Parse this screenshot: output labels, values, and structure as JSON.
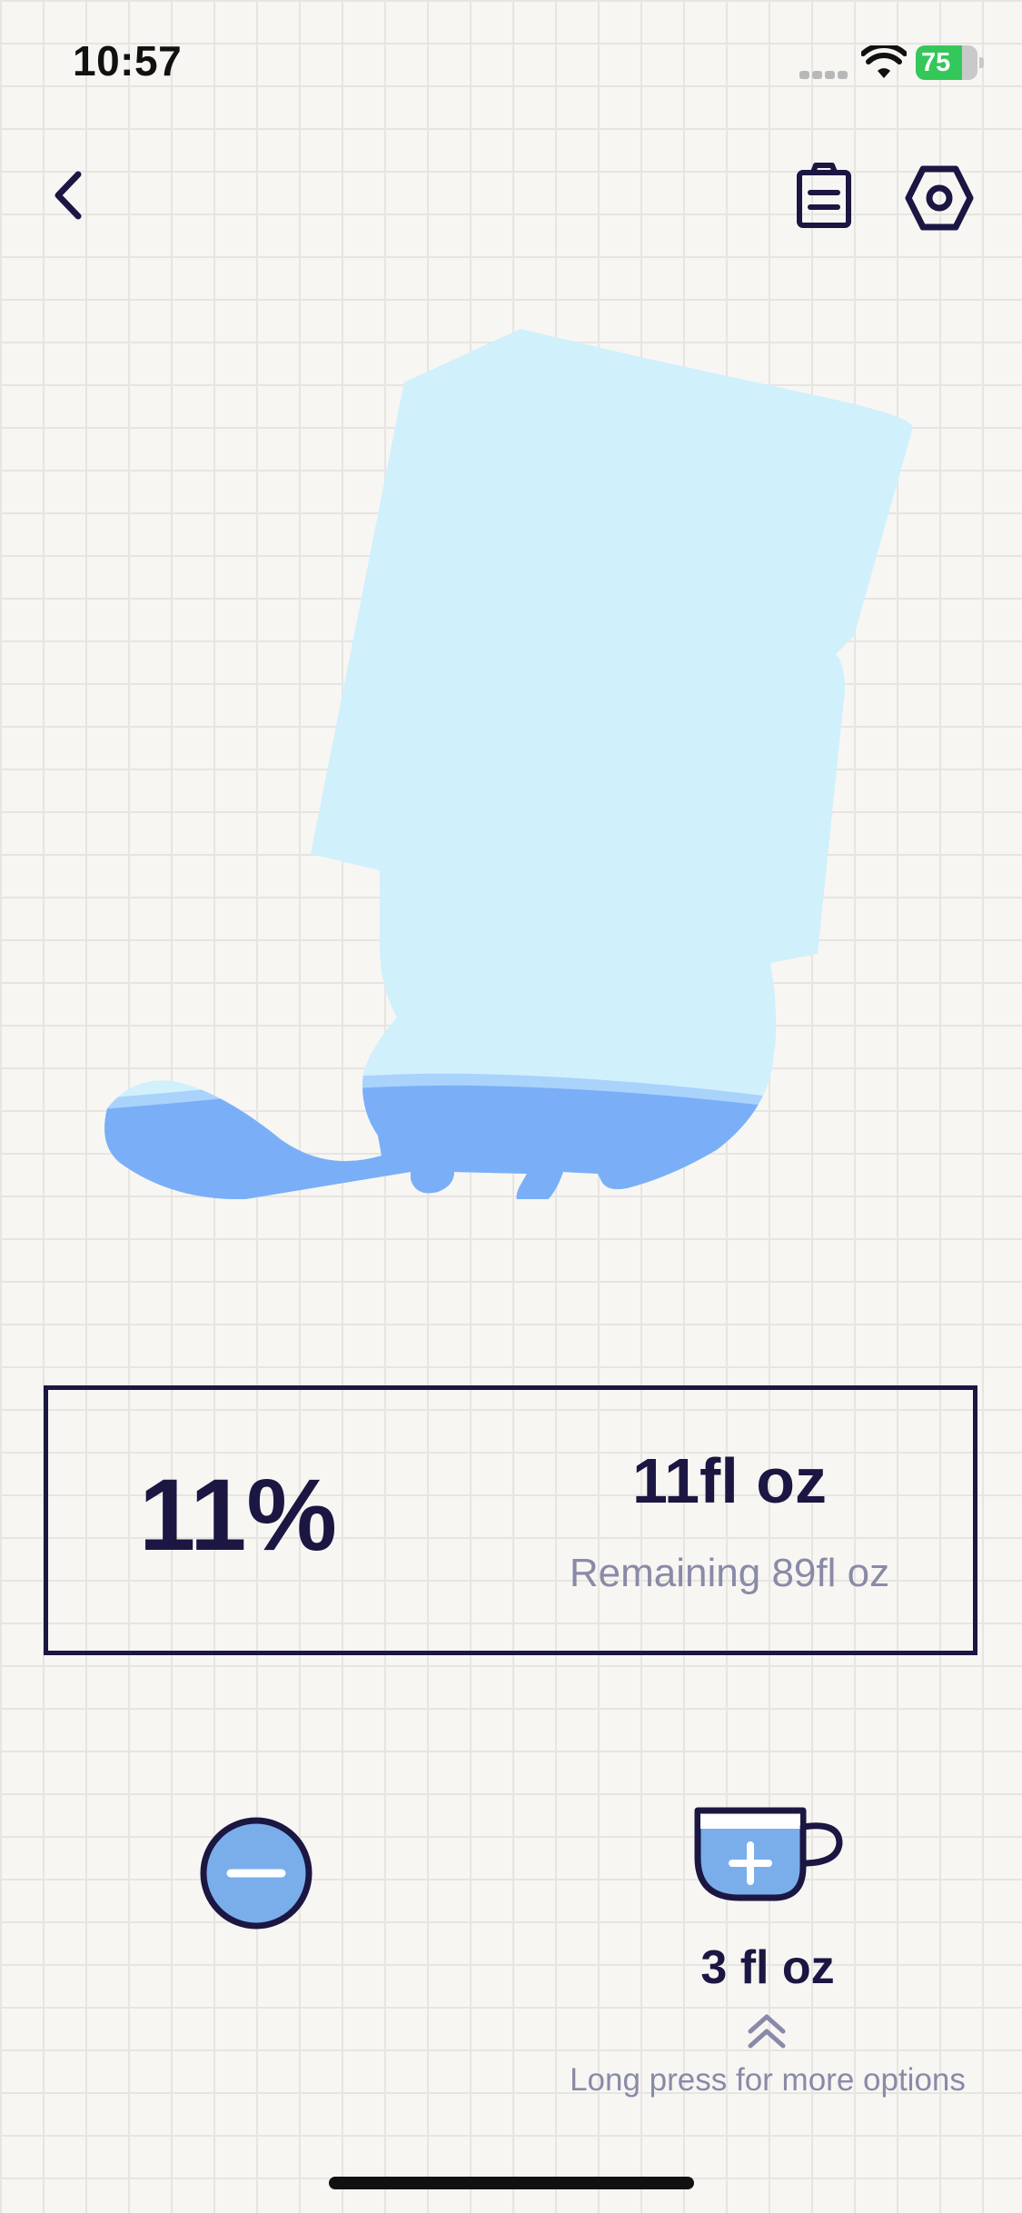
{
  "status_bar": {
    "time": "10:57",
    "battery_level": "75",
    "battery_fraction": 0.75,
    "battery_color": "#34c759"
  },
  "nav": {
    "back_icon": "chevron-left-icon",
    "history_icon": "clipboard-icon",
    "settings_icon": "hexagon-settings-icon"
  },
  "container": {
    "illustration": "boot-icon",
    "fill_fraction": 0.11,
    "empty_color": "#d0f0fc",
    "water_color": "#7aaff7"
  },
  "stats": {
    "percent": "11%",
    "amount": "11fl oz",
    "remaining": "Remaining 89fl oz"
  },
  "controls": {
    "remove_icon": "minus-circle-icon",
    "add_icon": "cup-plus-icon",
    "cup_amount": "3 fl oz",
    "chevron_icon": "chevron-up-double-icon",
    "hint": "Long press for more options"
  },
  "colors": {
    "ink": "#1c1642",
    "muted": "#8a8aa8",
    "button_fill": "#7aaeea",
    "background": "#f7f6f3"
  }
}
